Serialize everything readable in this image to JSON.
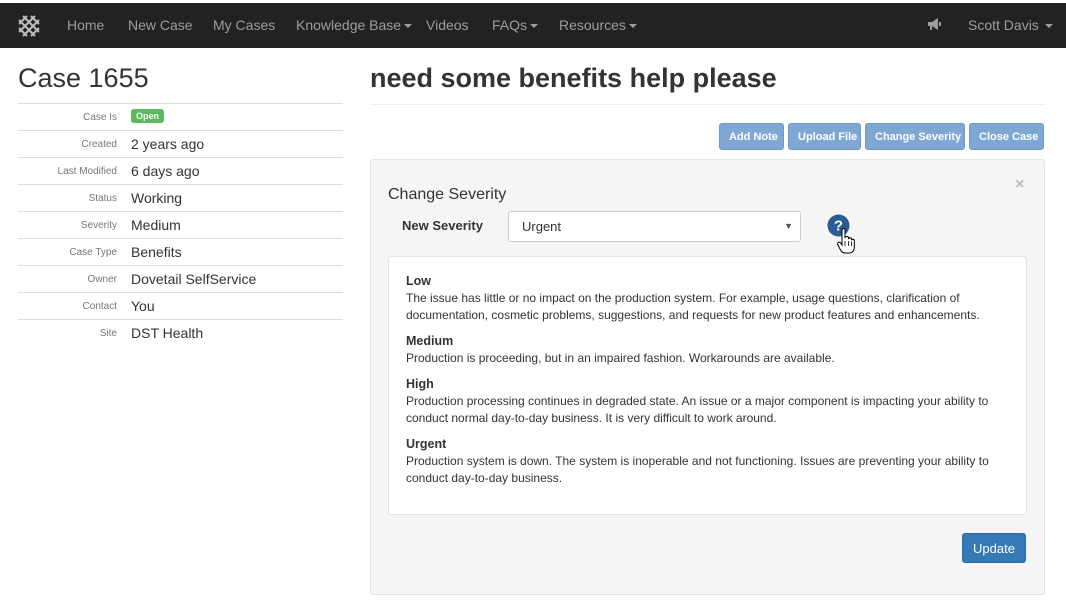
{
  "navbar": {
    "items": [
      {
        "label": "Home"
      },
      {
        "label": "New Case"
      },
      {
        "label": "My Cases"
      },
      {
        "label": "Knowledge Base"
      },
      {
        "label": "Videos"
      },
      {
        "label": "FAQs"
      },
      {
        "label": "Resources"
      }
    ],
    "user": "Scott Davis",
    "icons": [
      "logo-icon",
      "megaphone-icon"
    ]
  },
  "case": {
    "title": "Case 1655",
    "subject": "need some benefits help please",
    "details": [
      {
        "label": "Case Is",
        "value": "Open"
      },
      {
        "label": "Created",
        "value": "2 years ago"
      },
      {
        "label": "Last Modified",
        "value": "6 days ago"
      },
      {
        "label": "Status",
        "value": "Working"
      },
      {
        "label": "Severity",
        "value": "Medium"
      },
      {
        "label": "Case Type",
        "value": "Benefits"
      },
      {
        "label": "Owner",
        "value": "Dovetail SelfService"
      },
      {
        "label": "Contact",
        "value": "You"
      },
      {
        "label": "Site",
        "value": "DST Health"
      }
    ]
  },
  "actions": {
    "add_note": "Add Note",
    "upload_file": "Upload File",
    "change_severity": "Change Severity",
    "close_case": "Close Case"
  },
  "panel": {
    "title": "Change Severity",
    "close": "×",
    "severity_label": "New Severity",
    "severity_selected": "Urgent",
    "update_button": "Update",
    "descriptions": [
      {
        "title": "Low",
        "text": "The issue has little or no impact on the production system. For example, usage questions, clarification of documentation, cosmetic problems, suggestions, and requests for new product features and enhancements."
      },
      {
        "title": "Medium",
        "text": "Production is proceeding, but in an impaired fashion. Workarounds are available."
      },
      {
        "title": "High",
        "text": "Production processing continues in degraded state. An issue or a major component is impacting your ability to conduct normal day-to-day business. It is very difficult to work around."
      },
      {
        "title": "Urgent",
        "text": "Production system is down. The system is inoperable and not functioning. Issues are preventing your ability to conduct day-to-day business."
      }
    ]
  },
  "colors": {
    "navbar_bg": "#222222",
    "nav_text": "#9d9d9d",
    "badge_open": "#5cb85c",
    "action_button": "#7ea7d3",
    "primary_button": "#337ab7",
    "help_icon": "#2a5d94"
  }
}
